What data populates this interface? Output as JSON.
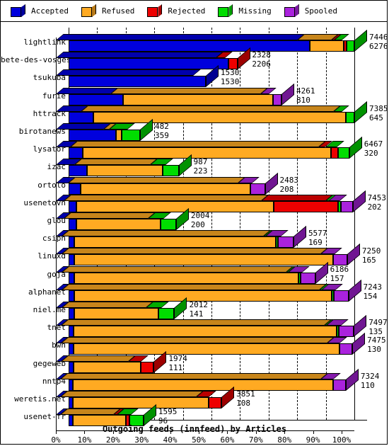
{
  "legend": {
    "items": [
      {
        "label": "Accepted",
        "color": "#0000dd",
        "icon": "cube-icon"
      },
      {
        "label": "Refused",
        "color": "#ffaa22",
        "icon": "cube-icon"
      },
      {
        "label": "Rejected",
        "color": "#ee0000",
        "icon": "cube-icon"
      },
      {
        "label": "Missing",
        "color": "#00dd00",
        "icon": "cube-icon"
      },
      {
        "label": "Spooled",
        "color": "#aa22dd",
        "icon": "cube-icon"
      }
    ]
  },
  "chart_data": {
    "type": "bar",
    "orientation": "horizontal",
    "stacked": true,
    "percent_stacked": true,
    "title": "Outgoing feeds (innfeed) by Articles",
    "xlabel": "Outgoing feeds (innfeed) by Articles",
    "ylabel": "",
    "xlim": [
      0,
      100
    ],
    "xticks": [
      "0%",
      "10%",
      "20%",
      "30%",
      "40%",
      "50%",
      "60%",
      "70%",
      "80%",
      "90%",
      "100%"
    ],
    "grid": true,
    "legend_position": "top",
    "series": [
      {
        "name": "Accepted",
        "color": "#0000dd"
      },
      {
        "name": "Refused",
        "color": "#ffaa22"
      },
      {
        "name": "Rejected",
        "color": "#ee0000"
      },
      {
        "name": "Missing",
        "color": "#00dd00"
      },
      {
        "name": "Spooled",
        "color": "#aa22dd"
      }
    ],
    "categories": [
      "lightlink",
      "bete-des-vosges",
      "tsukuba",
      "furie",
      "httrack",
      "birotanews",
      "lysator",
      "izac",
      "ortolo",
      "usenetovh",
      "glou",
      "csiph",
      "linuxd",
      "goja",
      "alphanet",
      "niel.me",
      "tnet",
      "bwh",
      "gegeweb",
      "nntp4",
      "weretis.net",
      "usenet-fr"
    ],
    "rows": [
      {
        "label": "lightlink",
        "total": "7446",
        "accepted": "6276",
        "pct": [
          84.3,
          12.0,
          0.9,
          2.8,
          0.0
        ],
        "bar_end": 100
      },
      {
        "label": "bete-des-vosges",
        "total": "2328",
        "accepted": "2206",
        "pct": [
          56.0,
          0.0,
          3.2,
          0.0,
          0.0
        ],
        "bar_end": 59
      },
      {
        "label": "tsukuba",
        "total": "1530",
        "accepted": "1530",
        "pct": [
          48.0,
          0.0,
          0.0,
          0.0,
          0.0
        ],
        "bar_end": 48
      },
      {
        "label": "furie",
        "total": "4261",
        "accepted": "810",
        "pct": [
          19.0,
          52.5,
          0.0,
          0.0,
          3.0
        ],
        "bar_end": 74.5
      },
      {
        "label": "httrack",
        "total": "7385",
        "accepted": "645",
        "pct": [
          8.7,
          88.3,
          0.0,
          3.0,
          0.0
        ],
        "bar_end": 100
      },
      {
        "label": "birotanews",
        "total": "482",
        "accepted": "359",
        "pct": [
          16.5,
          2.0,
          0.0,
          6.5,
          0.0
        ],
        "bar_end": 25
      },
      {
        "label": "lysator",
        "total": "6467",
        "accepted": "320",
        "pct": [
          4.9,
          87.0,
          2.3,
          4.0,
          0.0
        ],
        "bar_end": 98.2
      },
      {
        "label": "izac",
        "total": "987",
        "accepted": "223",
        "pct": [
          6.5,
          26.5,
          0.0,
          5.5,
          0.0
        ],
        "bar_end": 38.5
      },
      {
        "label": "ortolo",
        "total": "2483",
        "accepted": "208",
        "pct": [
          4.2,
          59.5,
          0.0,
          0.0,
          5.0
        ],
        "bar_end": 68.7
      },
      {
        "label": "usenetovh",
        "total": "7453",
        "accepted": "202",
        "pct": [
          2.7,
          69.0,
          22.5,
          1.2,
          4.0
        ],
        "bar_end": 99.4
      },
      {
        "label": "glou",
        "total": "2004",
        "accepted": "200",
        "pct": [
          2.6,
          29.5,
          0.0,
          5.5,
          0.0
        ],
        "bar_end": 37.6
      },
      {
        "label": "csiph",
        "total": "5577",
        "accepted": "169",
        "pct": [
          2.0,
          70.5,
          0.0,
          0.7,
          5.5
        ],
        "bar_end": 78.7
      },
      {
        "label": "linuxd",
        "total": "7250",
        "accepted": "165",
        "pct": [
          2.0,
          90.5,
          0.0,
          0.0,
          5.0
        ],
        "bar_end": 97.5
      },
      {
        "label": "goja",
        "total": "6186",
        "accepted": "157",
        "pct": [
          2.0,
          78.5,
          0.0,
          0.8,
          5.0
        ],
        "bar_end": 86.3
      },
      {
        "label": "alphanet",
        "total": "7243",
        "accepted": "154",
        "pct": [
          2.0,
          90.0,
          0.0,
          0.9,
          5.0
        ],
        "bar_end": 97.9
      },
      {
        "label": "niel.me",
        "total": "2012",
        "accepted": "141",
        "pct": [
          2.0,
          29.5,
          0.0,
          5.5,
          0.0
        ],
        "bar_end": 37.0
      },
      {
        "label": "tnet",
        "total": "7497",
        "accepted": "135",
        "pct": [
          1.8,
          92.0,
          0.0,
          0.8,
          5.2
        ],
        "bar_end": 99.8
      },
      {
        "label": "bwh",
        "total": "7475",
        "accepted": "130",
        "pct": [
          1.8,
          93.0,
          0.0,
          0.0,
          4.5
        ],
        "bar_end": 99.3
      },
      {
        "label": "gegeweb",
        "total": "1974",
        "accepted": "111",
        "pct": [
          1.8,
          23.5,
          4.5,
          0.0,
          0.0
        ],
        "bar_end": 29.8
      },
      {
        "label": "nntp4",
        "total": "7324",
        "accepted": "110",
        "pct": [
          1.5,
          91.0,
          0.0,
          0.0,
          4.5
        ],
        "bar_end": 97.0
      },
      {
        "label": "weretis.net",
        "total": "3851",
        "accepted": "108",
        "pct": [
          1.5,
          47.5,
          4.5,
          0.0,
          0.0
        ],
        "bar_end": 53.5
      },
      {
        "label": "usenet-fr",
        "total": "1595",
        "accepted": "96",
        "pct": [
          1.5,
          18.5,
          1.2,
          5.0,
          0.0
        ],
        "bar_end": 26.2
      }
    ]
  }
}
